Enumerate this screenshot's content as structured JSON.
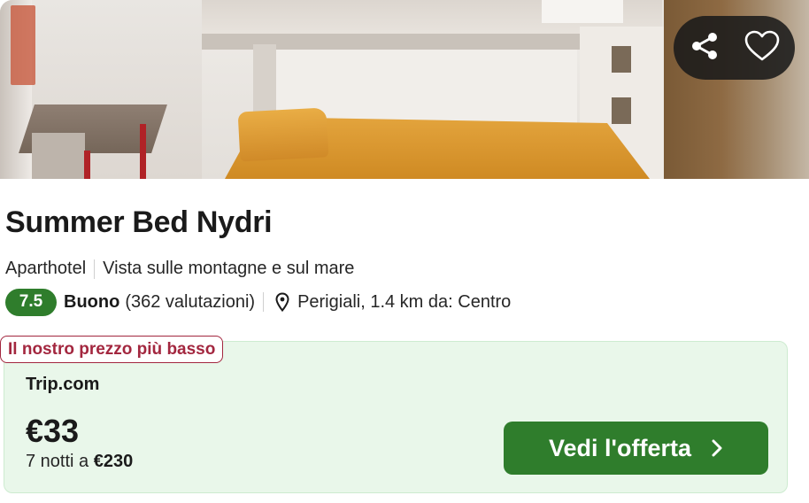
{
  "listing": {
    "title": "Summer Bed Nydri",
    "type": "Aparthotel",
    "view": "Vista sulle montagne e sul mare",
    "rating": {
      "score": "7.5",
      "label": "Buono",
      "reviews": "(362 valutazioni)"
    },
    "location": "Perigiali, 1.4 km da: Centro"
  },
  "actions": {
    "share_icon": "share-icon",
    "favorite_icon": "heart-icon"
  },
  "offer": {
    "badge": "Il nostro prezzo più basso",
    "provider": "Trip.com",
    "price": "€33",
    "nights_prefix": "7 notti a ",
    "total": "€230",
    "cta_label": "Vedi l'offerta"
  },
  "colors": {
    "brand_green": "#2f7d2c",
    "offer_bg": "#e9f7ea",
    "badge_red": "#a3273f"
  }
}
